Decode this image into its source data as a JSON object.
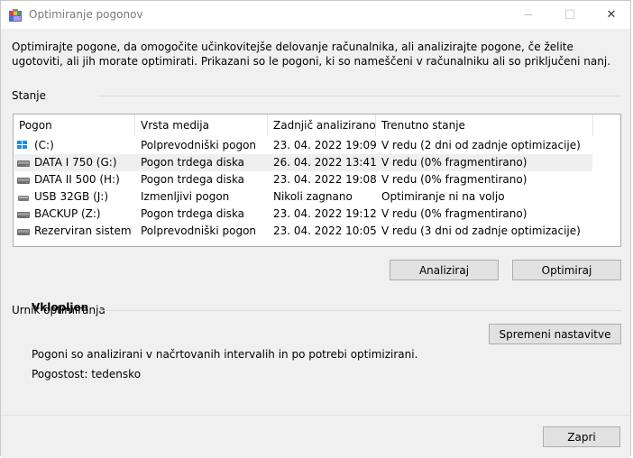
{
  "window": {
    "title": "Optimiranje pogonov",
    "minimize_glyph": "—",
    "maximize_glyph": "☐",
    "close_glyph": "✕"
  },
  "description": "Optimirajte pogone, da omogočite učinkovitejše delovanje računalnika, ali analizirajte pogone, če želite ugotoviti, ali jih morate optimirati. Prikazani so le pogoni, ki so nameščeni v računalniku ali so priključeni nanj.",
  "status_section": {
    "label": "Stanje"
  },
  "drives": {
    "columns": [
      "Pogon",
      "Vrsta medija",
      "Zadnjič analizirano...",
      "Trenutno stanje"
    ],
    "rows": [
      {
        "name": "(C:)",
        "icon": "windows-drive-icon",
        "media": "Polprevodniški pogon",
        "last": "23. 04. 2022 19:09",
        "status": "V redu (2 dni od zadnje optimizacije)"
      },
      {
        "name": "DATA I 750 (G:)",
        "icon": "hard-drive-icon",
        "media": "Pogon trdega diska",
        "last": "26. 04. 2022 13:41",
        "status": "V redu (0% fragmentirano)",
        "selected": true
      },
      {
        "name": "DATA II 500 (H:)",
        "icon": "hard-drive-icon",
        "media": "Pogon trdega diska",
        "last": "23. 04. 2022 19:08",
        "status": "V redu (0% fragmentirano)"
      },
      {
        "name": "USB 32GB (J:)",
        "icon": "usb-drive-icon",
        "media": "Izmenljivi pogon",
        "last": "Nikoli zagnano",
        "status": "Optimiranje ni na voljo"
      },
      {
        "name": "BACKUP (Z:)",
        "icon": "hard-drive-icon",
        "media": "Pogon trdega diska",
        "last": "23. 04. 2022 19:12",
        "status": "V redu (0% fragmentirano)"
      },
      {
        "name": "Rezerviran sistem",
        "icon": "hard-drive-icon",
        "media": "Polprevodniški pogon",
        "last": "23. 04. 2022 10:05",
        "status": "V redu (3 dni od zadnje optimizacije)"
      }
    ]
  },
  "actions": {
    "analyze": "Analiziraj",
    "optimize": "Optimiraj"
  },
  "schedule": {
    "label": "Urnik optimiranja",
    "state": "Vklopljen",
    "change_settings": "Spremeni nastavitve",
    "info": "Pogoni so analizirani v načrtovanih intervalih in po potrebi optimizirani.",
    "frequency": "Pogostost: tedensko"
  },
  "footer": {
    "close": "Zapri"
  }
}
